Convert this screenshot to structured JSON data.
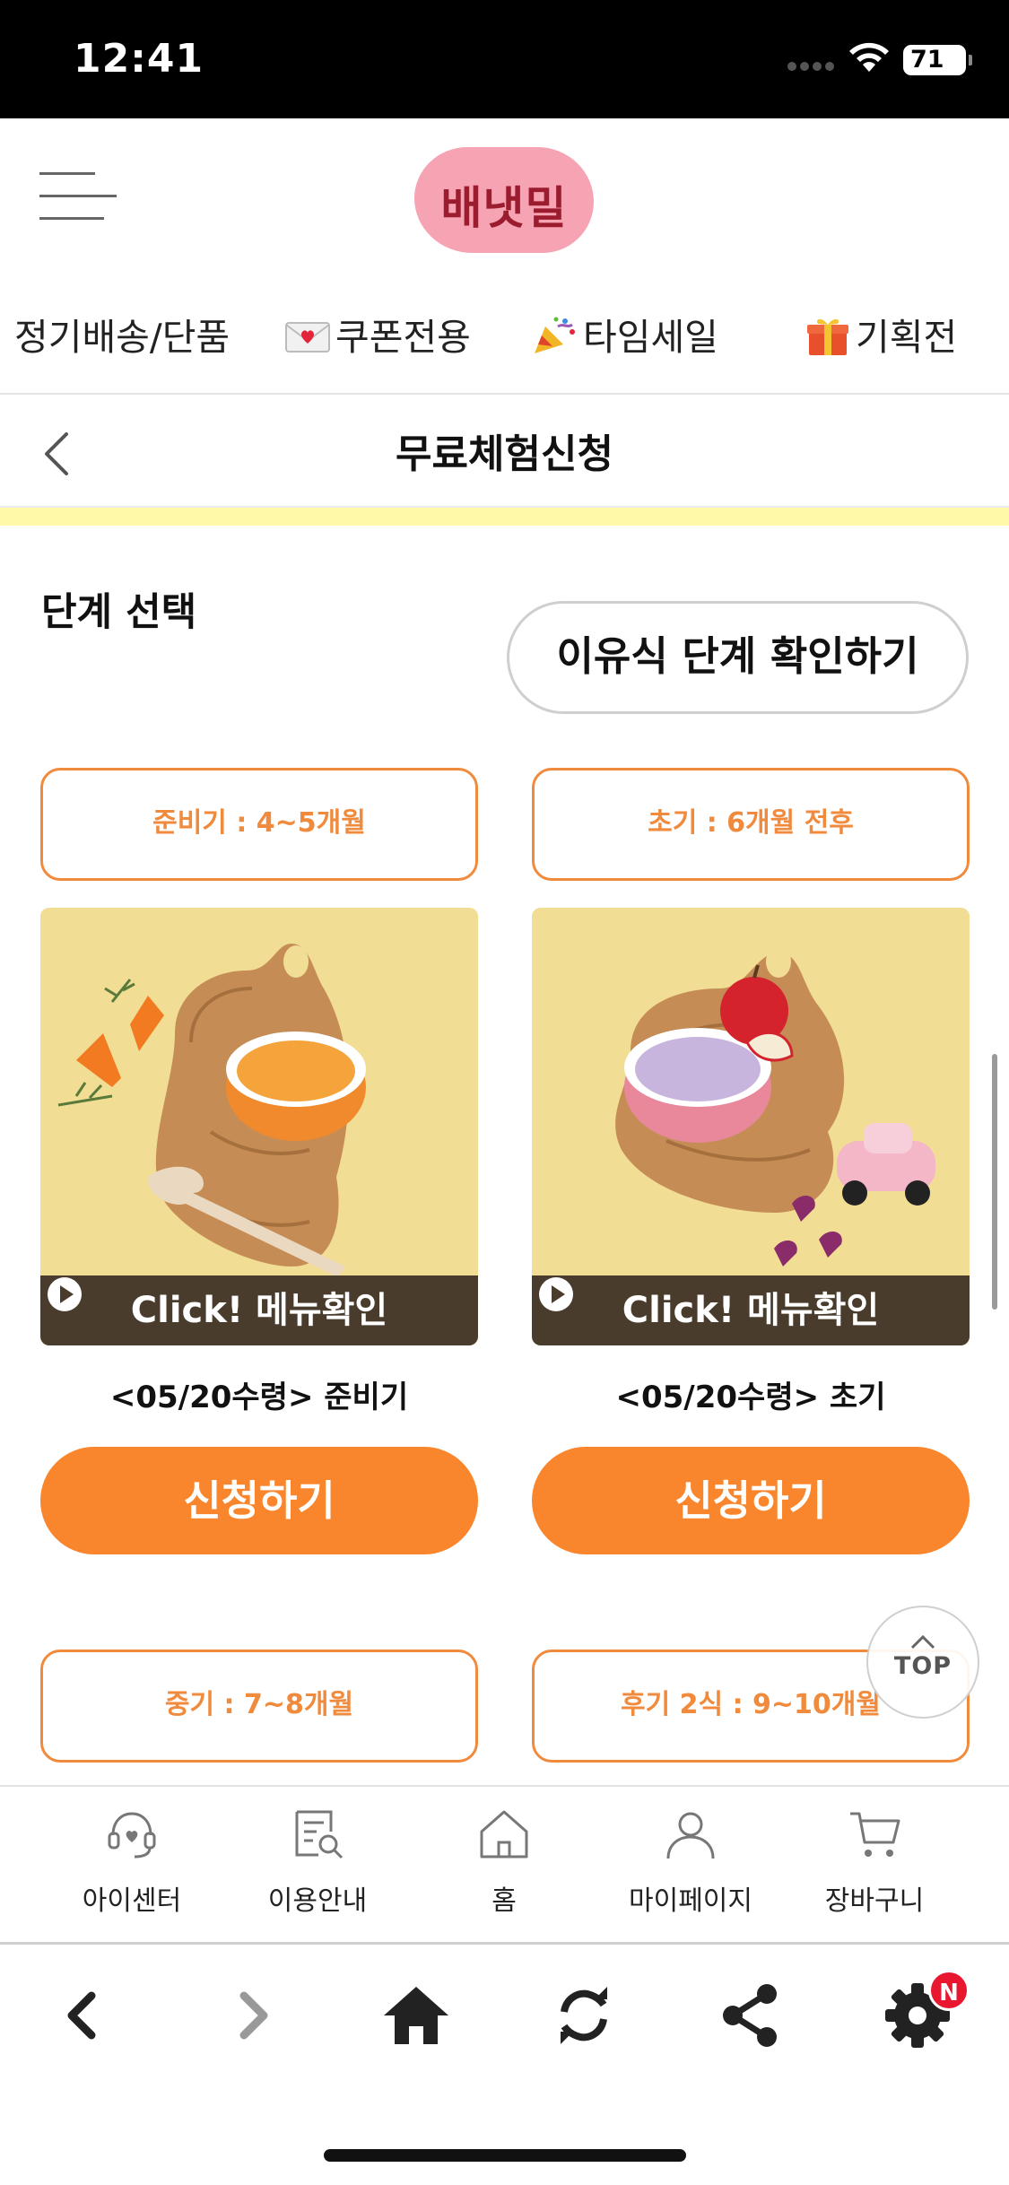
{
  "status_bar": {
    "time": "12:41",
    "battery": "71"
  },
  "header": {
    "logo_text": "배냇밀",
    "menu_icon": "hamburger-icon"
  },
  "category_nav": [
    {
      "label": "정기배송/단품",
      "icon": ""
    },
    {
      "label": "쿠폰전용",
      "icon": "love-letter-emoji"
    },
    {
      "label": "타임세일",
      "icon": "party-popper-emoji"
    },
    {
      "label": "기획전",
      "icon": "gift-emoji"
    }
  ],
  "page": {
    "title": "무료체험신청",
    "back_icon": "chevron-left-icon"
  },
  "step_section": {
    "heading": "단계 선택",
    "guide_button": "이유식 단계 확인하기"
  },
  "products": [
    {
      "stage": "준비기 : 4~5개월",
      "image_caption": "Click! 메뉴확인",
      "name": "<05/20수령> 준비기",
      "apply": "신청하기",
      "image": "orange-carrot-porridge"
    },
    {
      "stage": "초기 : 6개월 전후",
      "image_caption": "Click! 메뉴확인",
      "name": "<05/20수령> 초기",
      "apply": "신청하기",
      "image": "purple-apple-porridge"
    }
  ],
  "next_stages": [
    "중기 : 7~8개월",
    "후기 2식 : 9~10개월"
  ],
  "top_button": "TOP",
  "bottom_nav": [
    {
      "label": "아이센터",
      "icon": "headset-heart-icon"
    },
    {
      "label": "이용안내",
      "icon": "document-search-icon"
    },
    {
      "label": "홈",
      "icon": "house-outline-icon"
    },
    {
      "label": "마이페이지",
      "icon": "person-icon"
    },
    {
      "label": "장바구니",
      "icon": "cart-icon"
    }
  ],
  "browser_toolbar": {
    "icons": [
      "back-arrow-icon",
      "forward-arrow-icon",
      "home-icon",
      "refresh-icon",
      "share-icon",
      "settings-icon"
    ],
    "badge": "N"
  },
  "colors": {
    "accent": "#f9852c",
    "stage_border": "#f08a3c",
    "logo_pink": "#f6a3b4",
    "strip": "#fff9a8"
  }
}
